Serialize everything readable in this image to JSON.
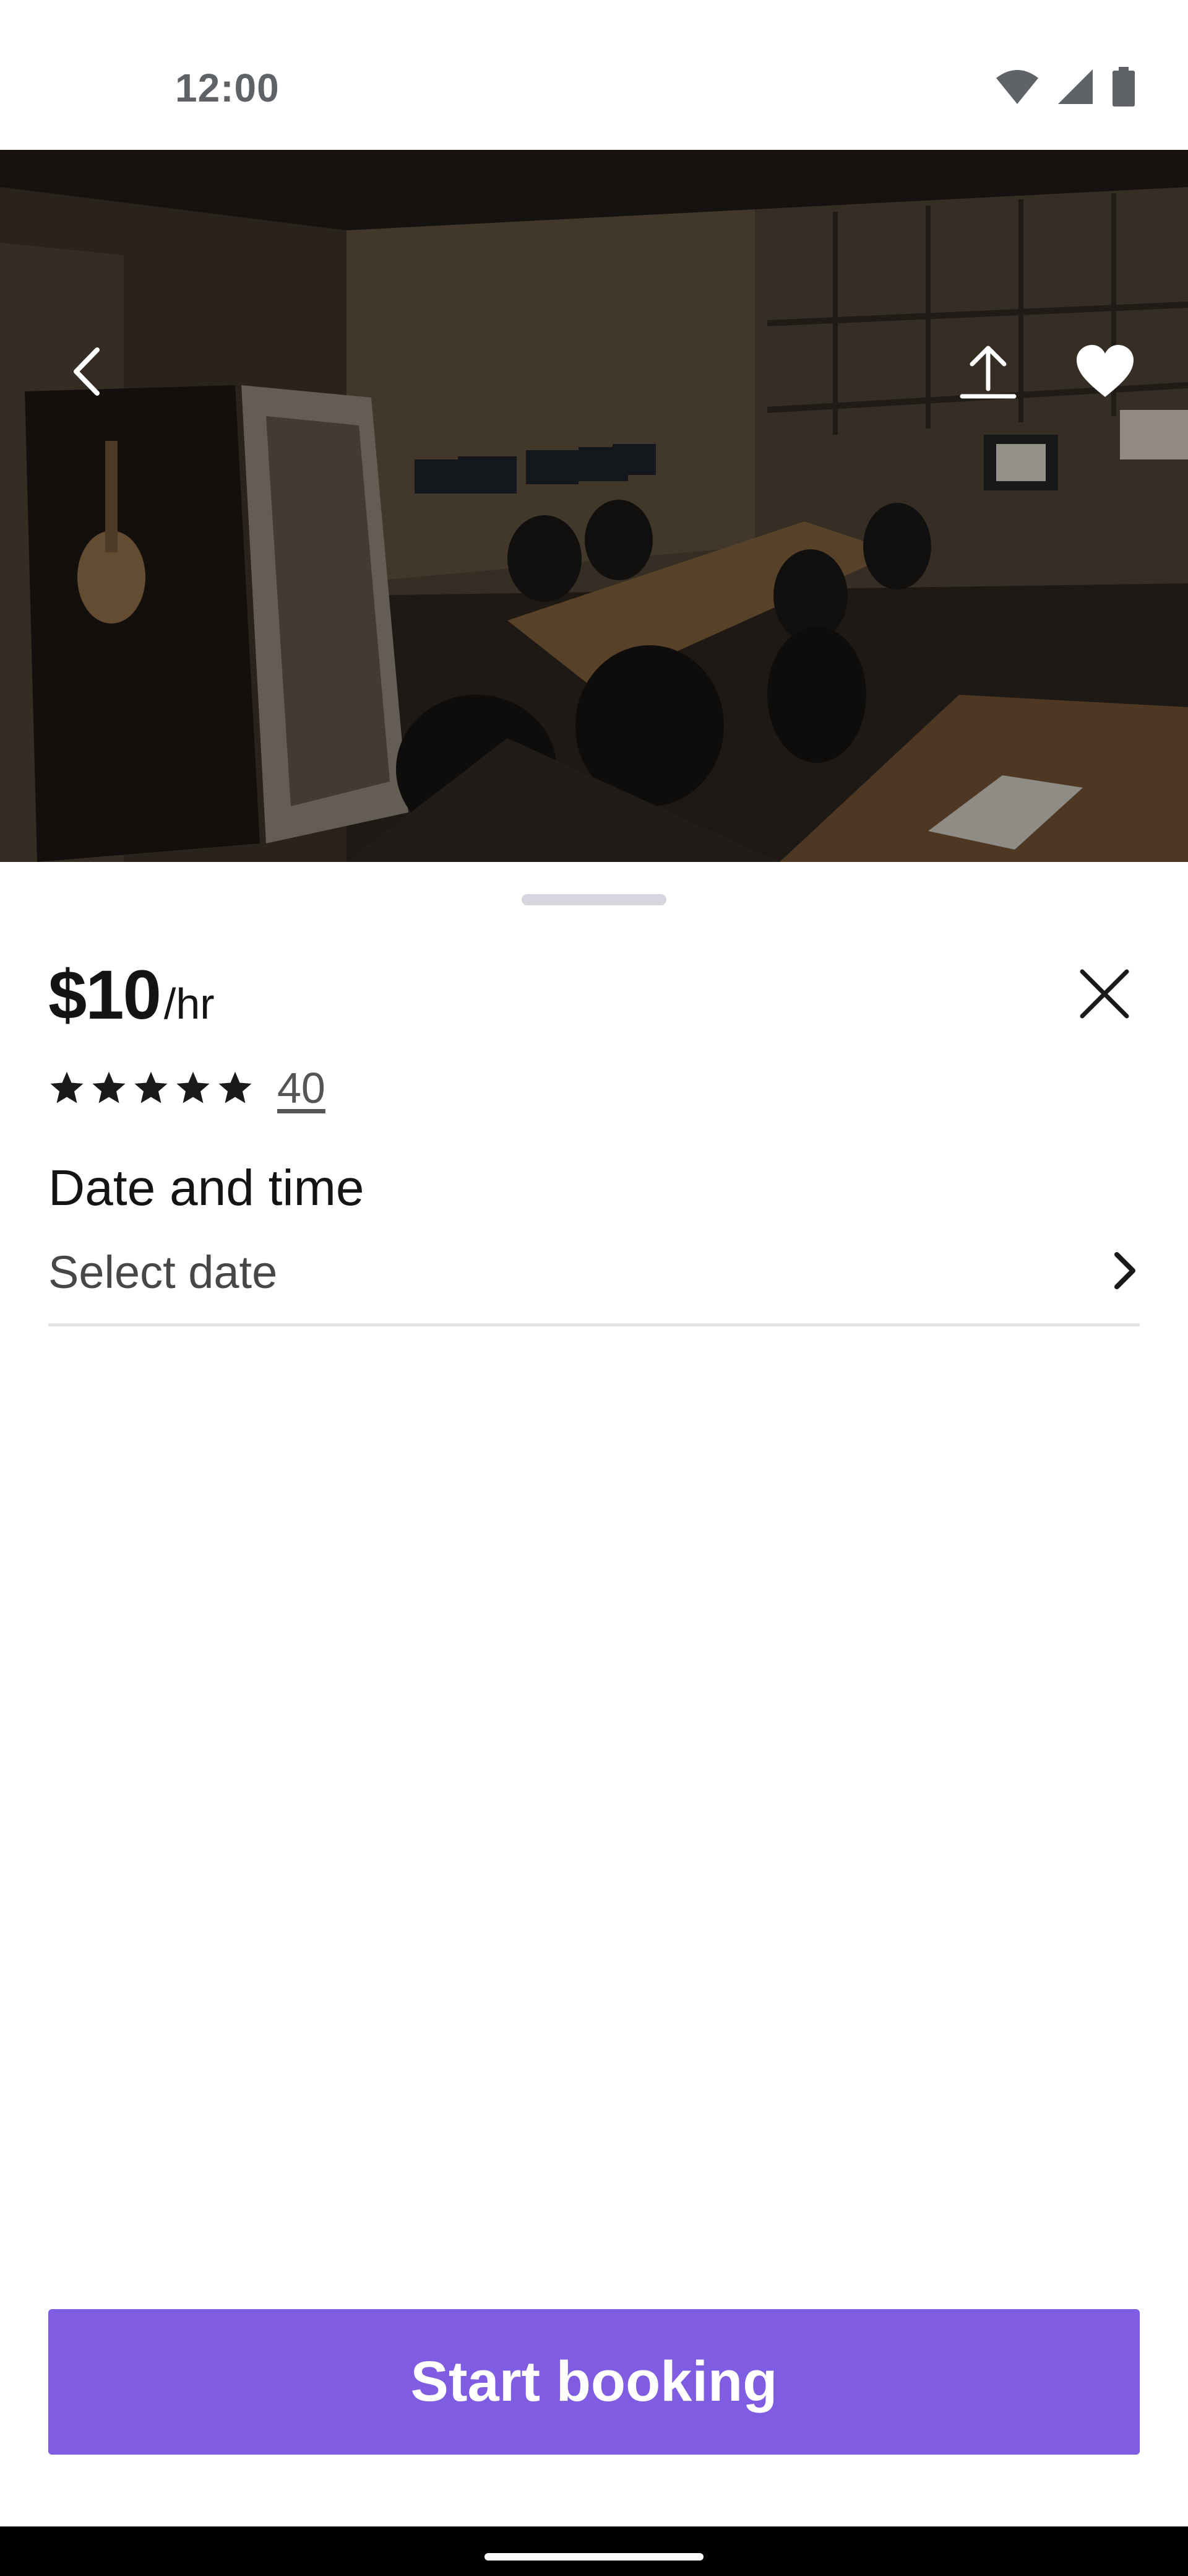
{
  "status_bar": {
    "time": "12:00",
    "icons": [
      "wifi-icon",
      "signal-icon",
      "battery-icon"
    ]
  },
  "hero": {
    "image_description": "dark photo of co-working room with desks, chairs and a booth",
    "buttons": [
      "back-arrow-icon",
      "share-icon",
      "heart-icon"
    ]
  },
  "listing": {
    "price": "$10",
    "price_unit": "/hr",
    "rating_stars": 5,
    "rating_count": "40",
    "date_section_title": "Date and time",
    "date_placeholder": "Select date"
  },
  "actions": {
    "start_booking_label": "Start booking"
  },
  "colors": {
    "accent": "#7f5ce1",
    "text_primary": "#141414",
    "text_secondary": "#474747",
    "divider": "#e3e3e3"
  }
}
